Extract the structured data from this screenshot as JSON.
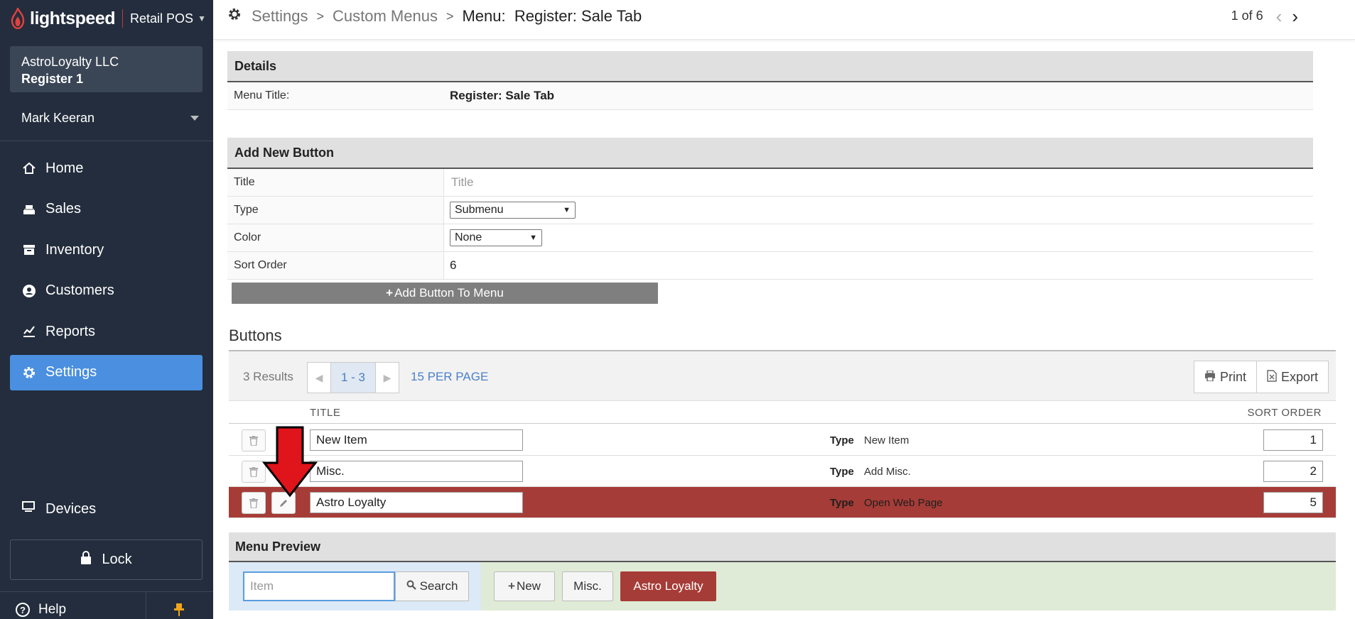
{
  "sidebar": {
    "brand": "lightspeed",
    "product": "Retail POS",
    "account_name": "AstroLoyalty LLC",
    "register": "Register 1",
    "user": "Mark Keeran",
    "nav": [
      {
        "label": "Home",
        "icon": "home-icon"
      },
      {
        "label": "Sales",
        "icon": "register-icon"
      },
      {
        "label": "Inventory",
        "icon": "box-icon"
      },
      {
        "label": "Customers",
        "icon": "user-circle-icon"
      },
      {
        "label": "Reports",
        "icon": "chart-icon"
      },
      {
        "label": "Settings",
        "icon": "gear-icon",
        "active": true
      }
    ],
    "devices": "Devices",
    "lock": "Lock",
    "help": "Help"
  },
  "topbar": {
    "crumbs": [
      "Settings",
      "Custom Menus"
    ],
    "current": "Menu:  Register: Sale Tab",
    "pager": "1 of 6"
  },
  "details": {
    "heading": "Details",
    "menu_title_label": "Menu Title:",
    "menu_title_value": "Register: Sale Tab"
  },
  "add_new": {
    "heading": "Add New Button",
    "title_label": "Title",
    "title_placeholder": "Title",
    "type_label": "Type",
    "type_value": "Submenu",
    "color_label": "Color",
    "color_value": "None",
    "sort_label": "Sort Order",
    "sort_value": "6",
    "add_button": "Add Button To Menu"
  },
  "buttons": {
    "heading": "Buttons",
    "results": "3 Results",
    "range": "1 - 3",
    "per_page": "15 PER PAGE",
    "print": "Print",
    "export": "Export",
    "col_title": "TITLE",
    "col_sort": "SORT ORDER",
    "type_label": "Type",
    "rows": [
      {
        "title": "New Item",
        "type": "New Item",
        "sort": "1"
      },
      {
        "title": "Misc.",
        "type": "Add Misc.",
        "sort": "2"
      },
      {
        "title": "Astro Loyalty",
        "type": "Open Web Page",
        "sort": "5"
      }
    ]
  },
  "preview": {
    "heading": "Menu Preview",
    "search_placeholder": "Item",
    "search_button": "Search",
    "buttons": [
      "New",
      "Misc.",
      "Astro Loyalty"
    ]
  },
  "colors": {
    "sidebar_bg": "#232d3d",
    "active_nav": "#4a8fe0",
    "highlight_row": "#a63c37",
    "arrow": "#e0141b"
  }
}
